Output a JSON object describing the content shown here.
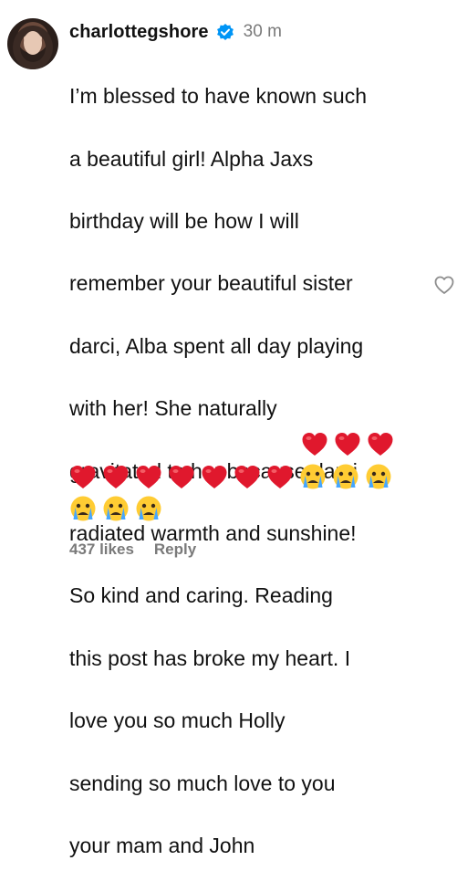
{
  "comment": {
    "username": "charlottegshore",
    "time": "30 m",
    "text_lines": [
      "I’m blessed to have known such",
      "a beautiful girl! Alpha Jaxs",
      "birthday will be how I will",
      "remember your beautiful sister",
      "darci, Alba spent all day playing",
      "with her! She naturally",
      "gravitated to her because darci",
      "radiated warmth and sunshine!",
      "So kind and caring. Reading",
      "this post has broke my heart. I",
      "love you so much Holly",
      "sending so much love to you",
      "your mam and John"
    ],
    "likes": "437 likes",
    "reply": "Reply"
  },
  "emojis": {
    "line13": [
      "heart-icon",
      "heart-icon",
      "heart-icon"
    ],
    "line14": [
      "heart-icon",
      "heart-icon",
      "heart-icon",
      "heart-icon",
      "heart-icon",
      "heart-icon",
      "heart-icon",
      "crying-face-icon",
      "crying-face-icon",
      "crying-face-icon"
    ],
    "line15": [
      "crying-face-icon",
      "crying-face-icon",
      "crying-face-icon"
    ]
  },
  "colors": {
    "heart": "#e0182d",
    "verified": "#0095f6",
    "muted": "#7a7a7a",
    "text": "#111111"
  }
}
